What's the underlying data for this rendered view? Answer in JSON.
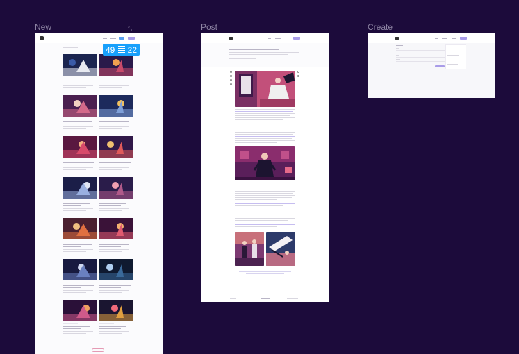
{
  "frames": {
    "new": {
      "label": "New"
    },
    "post": {
      "label": "Post"
    },
    "create": {
      "label": "Create"
    }
  },
  "counter": {
    "left": "49",
    "right": "22"
  },
  "colors": {
    "canvas": "#1c0b3b",
    "frame_label": "#8d84a3",
    "selection": "#18a0fb",
    "accent_purple": "#a99ce8",
    "accent_blue": "#5aa0f0",
    "load_more": "#e06690"
  },
  "icons": {
    "dimensions": "resize-corner-icon",
    "counter": "distribute-spacing-icon"
  }
}
